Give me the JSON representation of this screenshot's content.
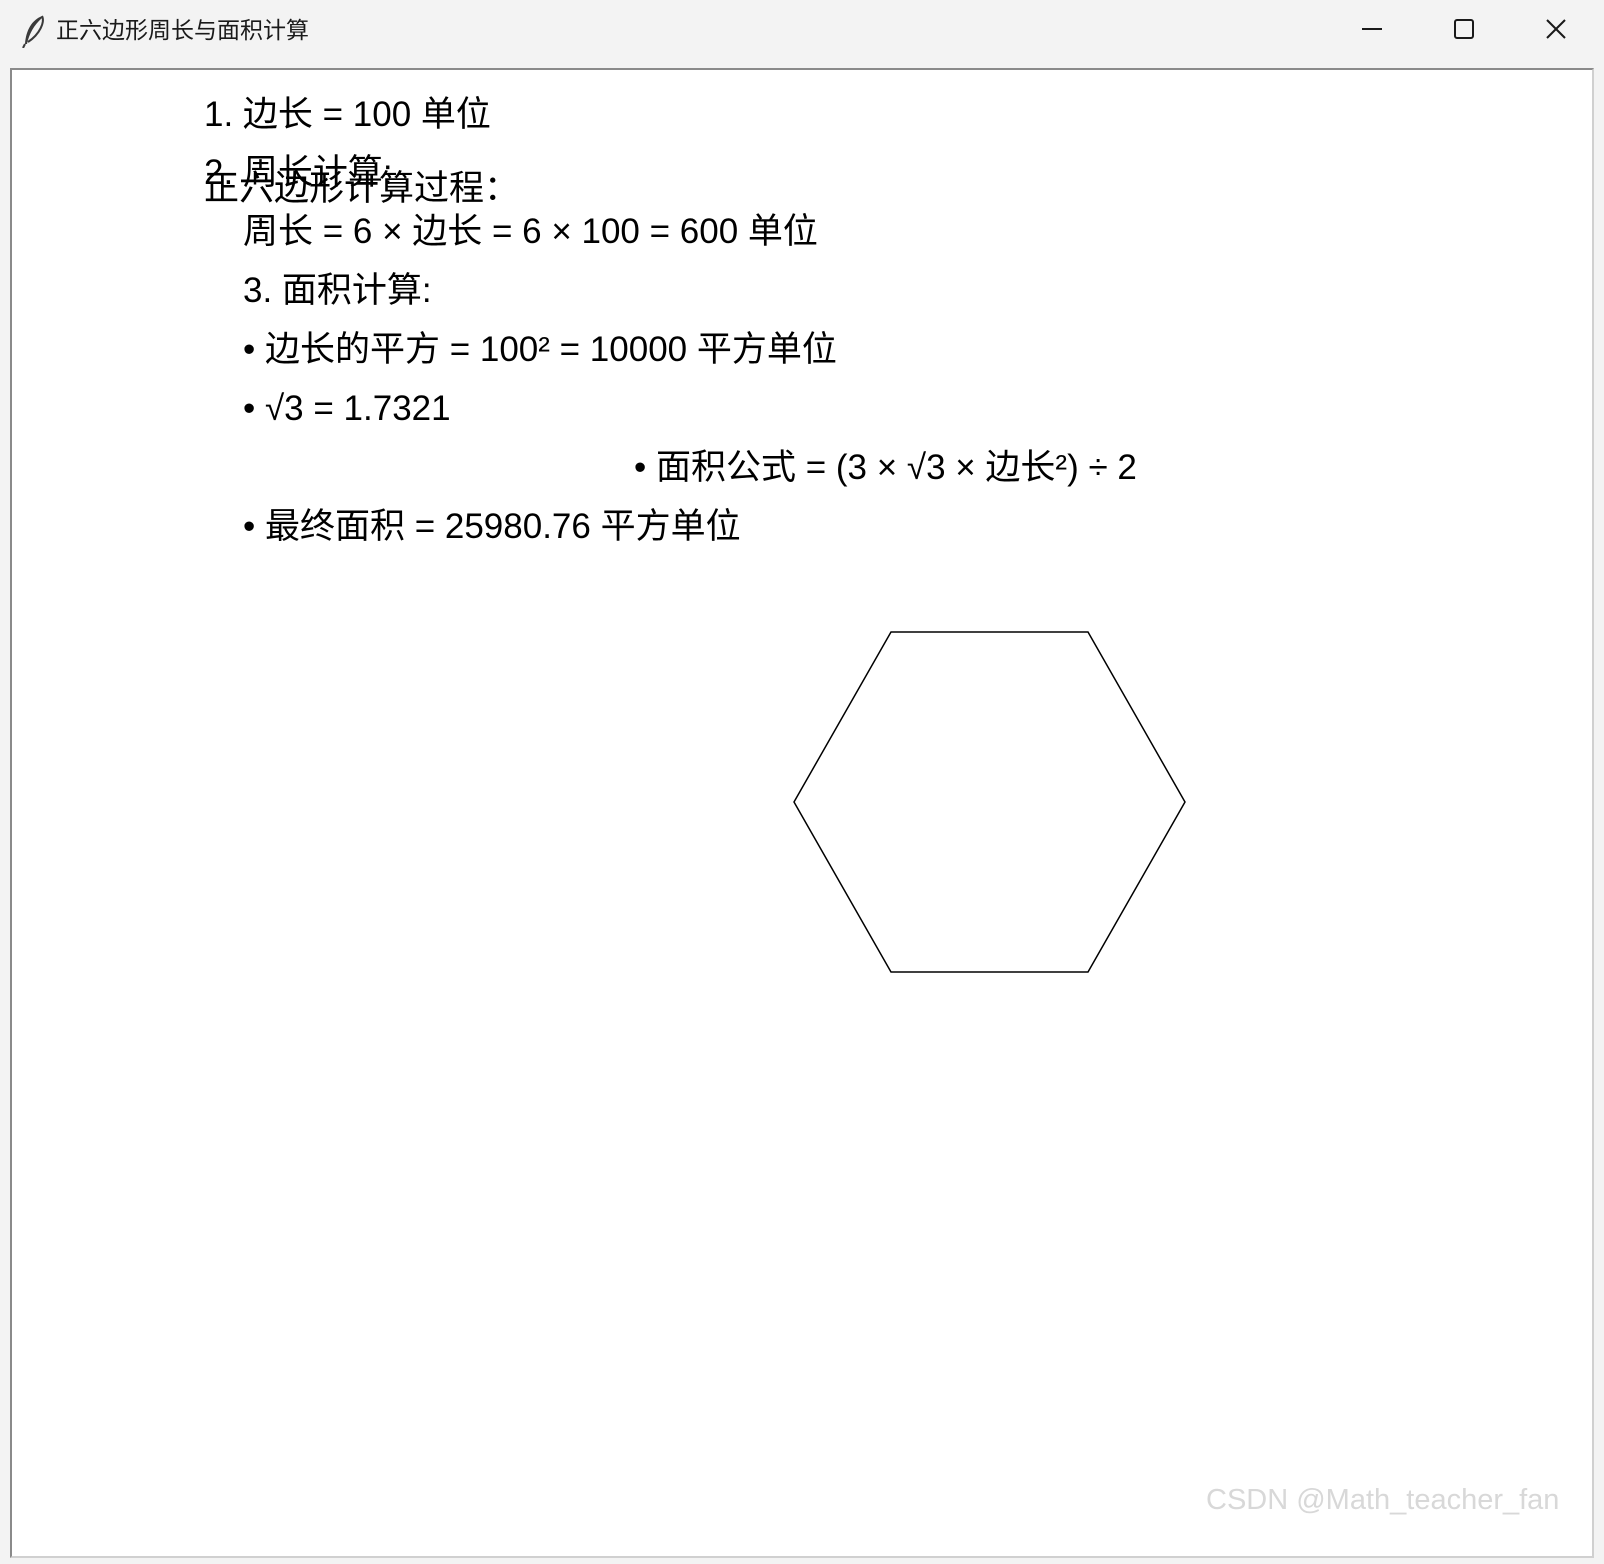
{
  "window": {
    "title": "正六边形周长与面积计算",
    "icon": "feather-icon"
  },
  "controls": {
    "minimize_icon": "minimize-icon",
    "maximize_icon": "maximize-icon",
    "close_icon": "close-icon"
  },
  "content": {
    "heading": "正六边形计算过程：",
    "step1": "1. 边长 = 100 单位",
    "step2": "2. 周长计算:",
    "perimeter": "周长 = 6 × 边长 = 6 × 100 = 600 单位",
    "step3": "3. 面积计算:",
    "side_squared": "• 边长的平方 = 100² = 10000 平方单位",
    "sqrt3": "• √3 = 1.7321",
    "area_formula": "• 面积公式 = (3 × √3 × 边长²) ÷ 2",
    "final_area": "• 最终面积 = 25980.76 平方单位"
  },
  "shape": {
    "type": "hexagon",
    "side_length": 100,
    "stroke_color": "#000000",
    "fill": "none"
  },
  "watermark": "CSDN @Math_teacher_fan"
}
